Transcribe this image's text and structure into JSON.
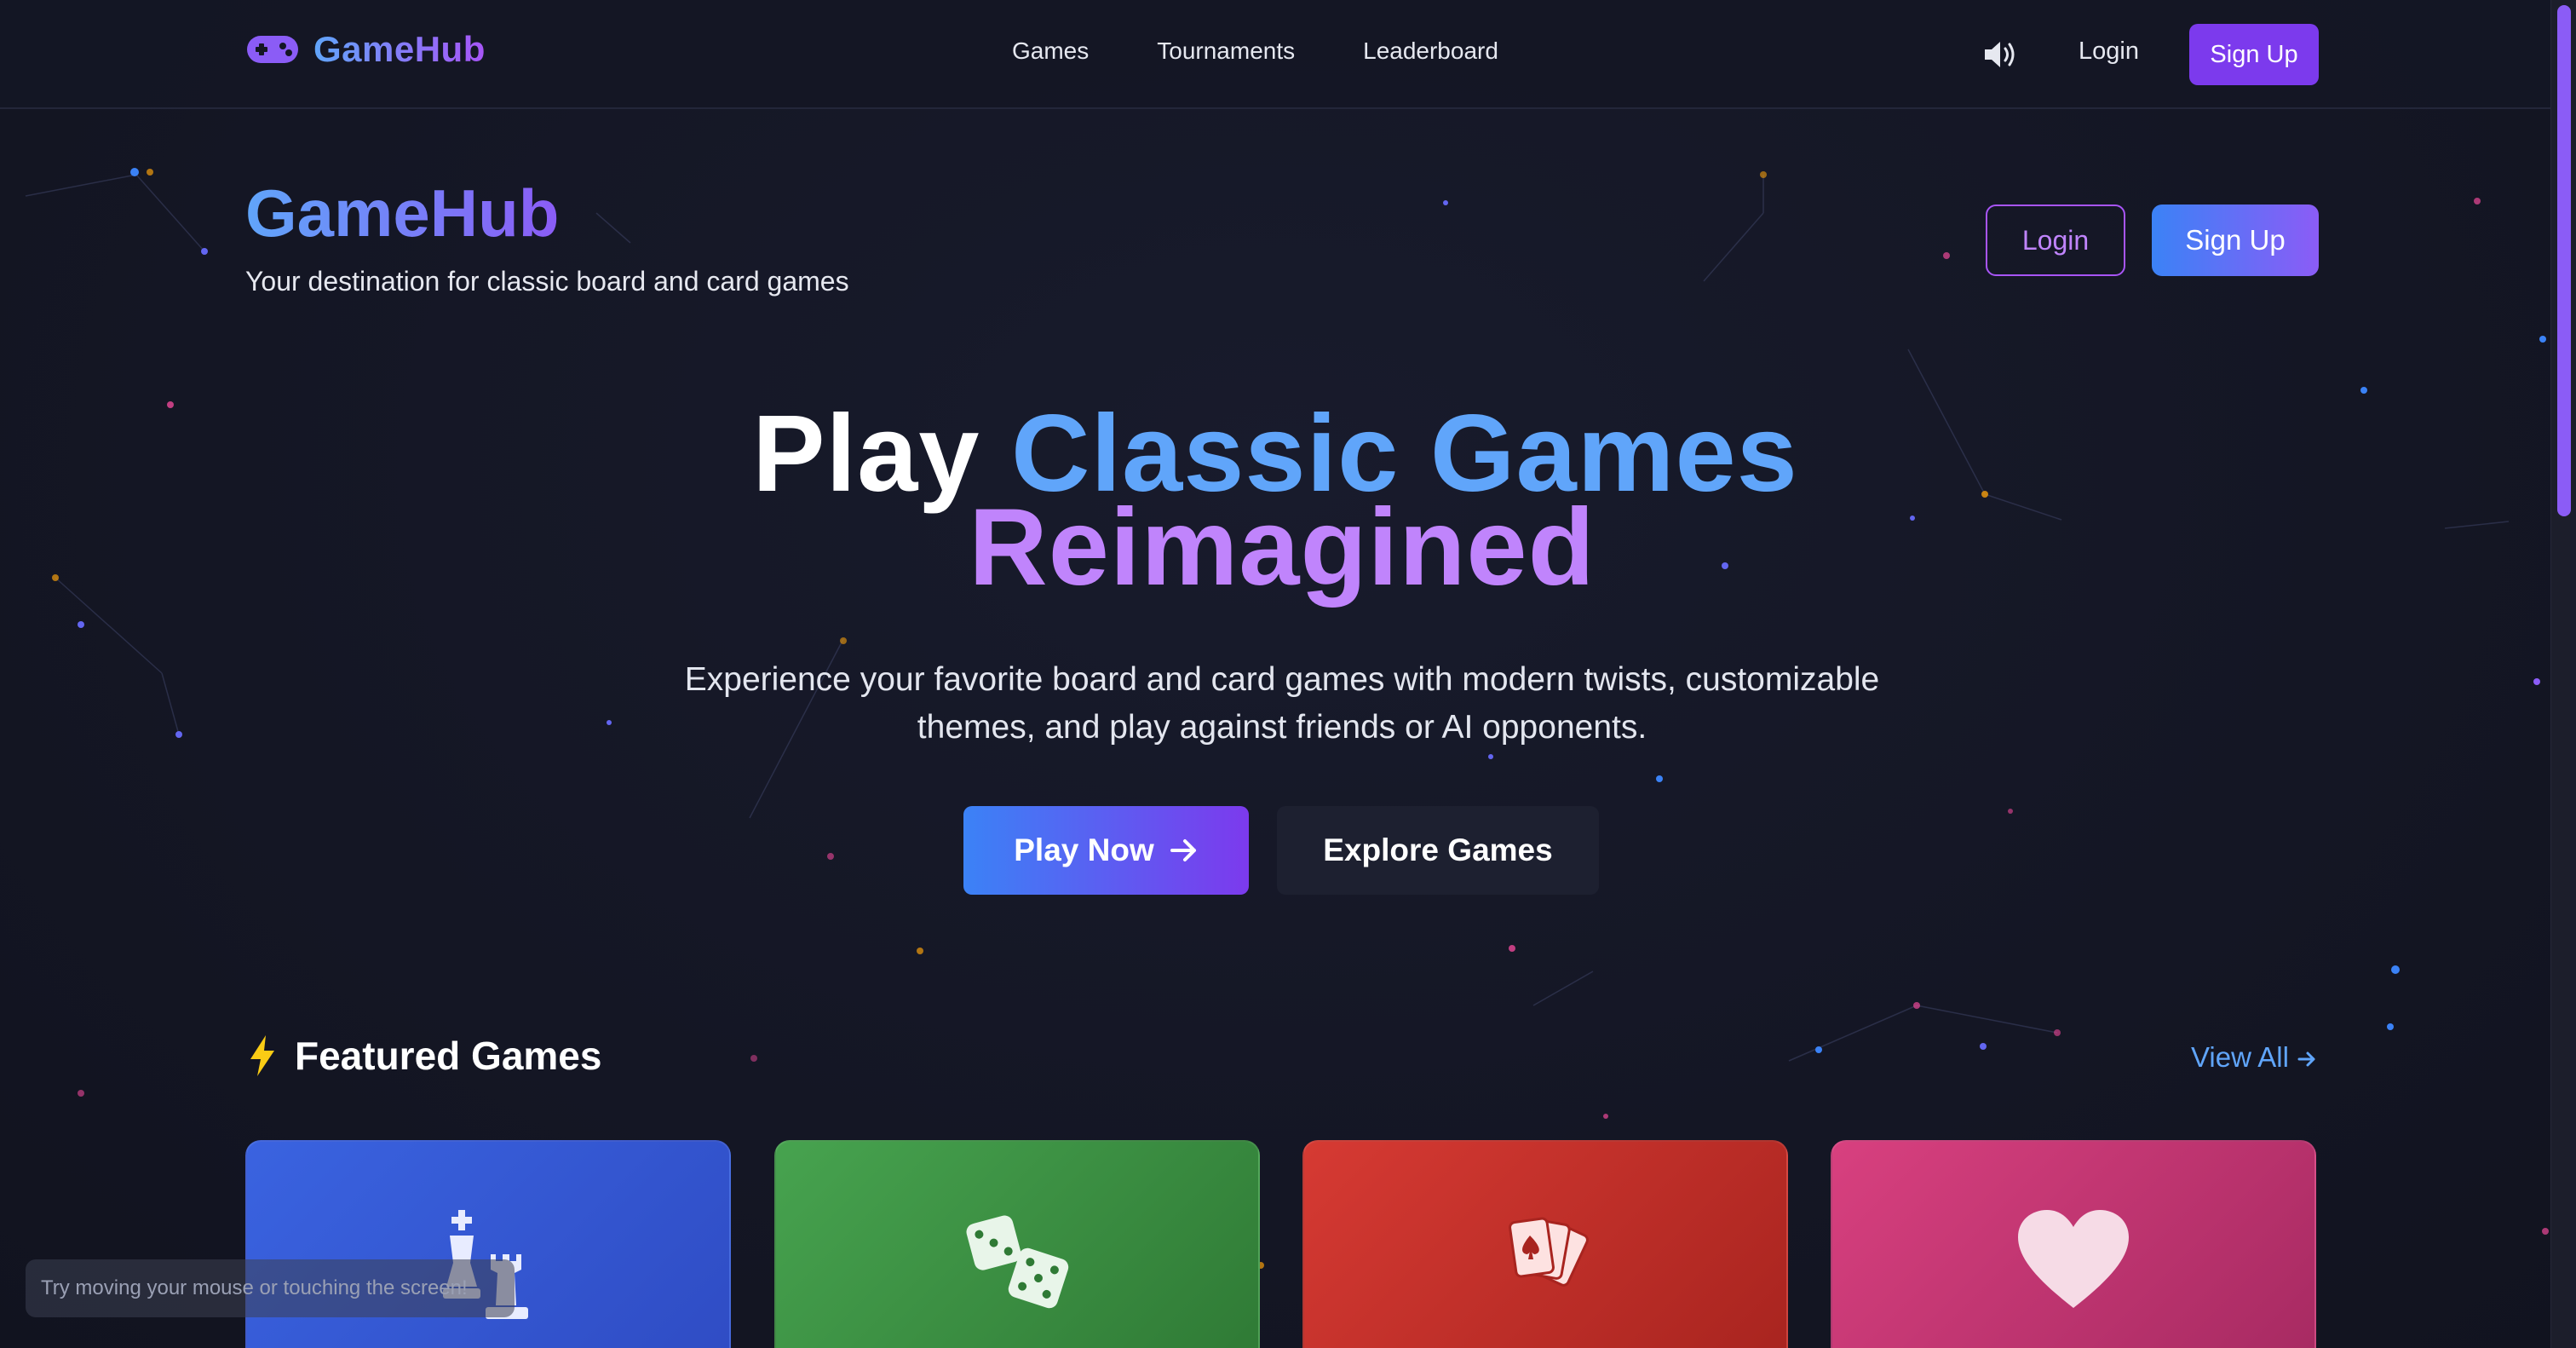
{
  "nav": {
    "brand": "GameHub",
    "links": [
      "Games",
      "Tournaments",
      "Leaderboard"
    ],
    "login": "Login",
    "signup": "Sign Up",
    "icons": [
      "gamepad-icon",
      "speaker-icon"
    ]
  },
  "header": {
    "title": "GameHub",
    "tagline": "Your destination for classic board and card games",
    "login": "Login",
    "signup": "Sign Up"
  },
  "hero": {
    "headline_white": "Play",
    "headline_blue": "Classic Games",
    "headline_purple": "Reimagined",
    "description": "Experience your favorite board and card games with modern twists, customizable themes, and play against friends or AI opponents.",
    "play_button": "Play Now",
    "explore_button": "Explore Games"
  },
  "featured": {
    "title": "Featured Games",
    "view_all": "View All",
    "cards": [
      {
        "icon": "chess-icon",
        "color": "#3a63e0"
      },
      {
        "icon": "dice-icon",
        "color": "#47a34f"
      },
      {
        "icon": "playing-cards-icon",
        "color": "#d63a33"
      },
      {
        "icon": "heart-icon",
        "color": "#d8407f"
      }
    ]
  },
  "hint": "Try moving your mouse or touching the screen!",
  "colors": {
    "background": "#141624",
    "accent_blue": "#60a5fa",
    "accent_purple": "#a855f7",
    "button_purple": "#7c3aed"
  }
}
